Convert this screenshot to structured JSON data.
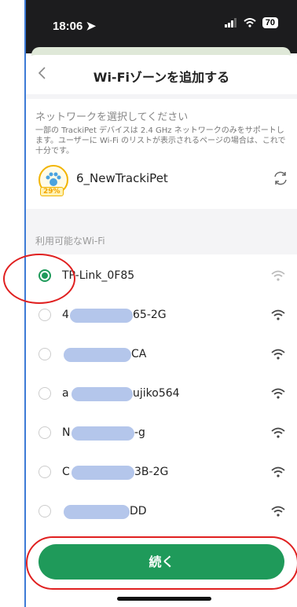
{
  "status_bar": {
    "time": "18:06",
    "battery": "70"
  },
  "header": {
    "title": "Wi-Fiゾーンを追加する"
  },
  "network_select": {
    "title": "ネットワークを選択してください",
    "description": "一部の TrackiPet デバイスは 2.4 GHz ネットワークのみをサポートします。ユーザーに Wi-Fi のリストが表示されるページの場合は、これで十分です。",
    "device": {
      "name": "6_NewTrackiPet",
      "battery_badge": "29%"
    }
  },
  "wifi_section_label": "利用可能なWi-Fi",
  "wifi_networks": [
    {
      "name": "TP-Link_0F85",
      "selected": true
    },
    {
      "name": "65-2G",
      "prefix": "4",
      "selected": false
    },
    {
      "name": "CA",
      "prefix": "",
      "selected": false
    },
    {
      "name": "ujiko564",
      "prefix": "a",
      "selected": false
    },
    {
      "name": "-g",
      "prefix": "N",
      "selected": false
    },
    {
      "name": "3B-2G",
      "prefix": "C",
      "selected": false
    },
    {
      "name": "DD",
      "prefix": "",
      "selected": false
    }
  ],
  "continue_button": {
    "label": "続く"
  },
  "colors": {
    "accent": "#1f9a5a",
    "annotation": "#e02020"
  }
}
